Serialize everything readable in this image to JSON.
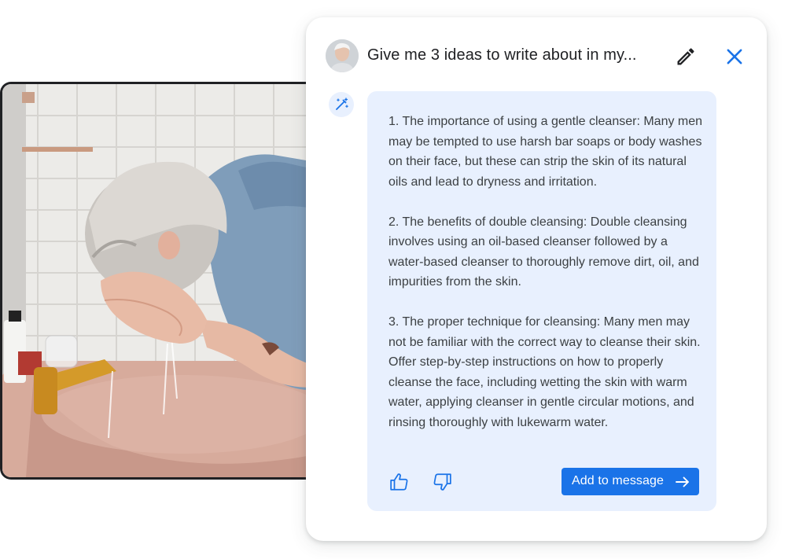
{
  "chat": {
    "prompt_title": "Give me 3 ideas to write about in my...",
    "response_paragraphs": [
      "1. The importance of using a gentle cleanser: Many men may be tempted  to use harsh bar soaps or body washes on their face, but these can strip the skin of its natural oils and lead to dryness and irritation.",
      "2. The benefits of double cleansing: Double cleansing involves using an oil-based cleanser followed by a water-based cleanser to thoroughly remove dirt, oil, and impurities from the skin.",
      "3. The proper technique for cleansing: Many men may not be familiar with the correct way to cleanse their skin. Offer step-by-step instructions on how to properly cleanse the face, including wetting the skin with warm water, applying cleanser in gentle circular motions, and rinsing thoroughly with lukewarm water."
    ],
    "add_button_label": "Add to message"
  },
  "icons": {
    "avatar": "user-avatar",
    "edit": "pencil-icon",
    "close": "close-icon",
    "ai": "magic-wand-icon",
    "like": "thumbs-up-icon",
    "dislike": "thumbs-down-icon",
    "send": "arrow-right-icon"
  },
  "colors": {
    "accent": "#1a73e8",
    "response_bg": "#e8f0fe",
    "text": "#3c4043",
    "title": "#202124"
  }
}
